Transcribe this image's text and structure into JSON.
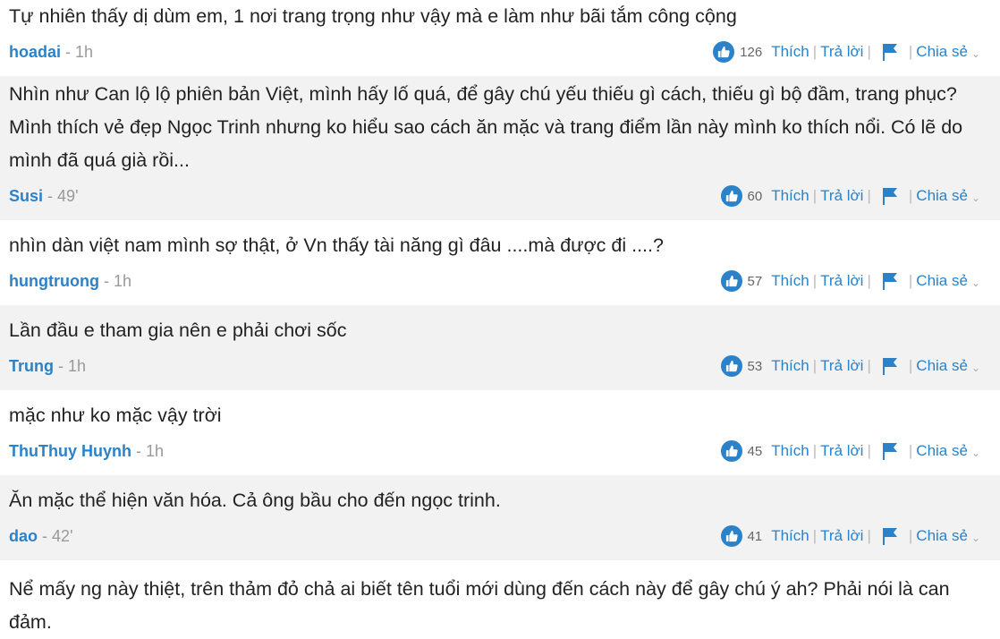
{
  "comments": [
    {
      "text": "Tự nhiên thấy dị dùm em, 1 nơi trang trọng như vậy mà e làm như bãi tắm công cộng",
      "author": "hoadai",
      "time": "1h",
      "likes": "126"
    },
    {
      "text": "Nhìn như Can lộ lộ phiên bản Việt, mình hấy lố quá, để gây chú yếu thiếu gì cách, thiếu gì bộ đầm, trang phục? Mình thích vẻ đẹp Ngọc Trinh nhưng ko hiểu sao cách ăn mặc và trang điểm lần này mình ko thích nổi. Có lẽ do mình đã quá già rồi...",
      "author": "Susi",
      "time": "49'",
      "likes": "60"
    },
    {
      "text": "nhìn dàn việt nam mình sợ thật, ở Vn thấy tài năng gì đâu ....mà được đi ....?",
      "author": "hungtruong",
      "time": "1h",
      "likes": "57"
    },
    {
      "text": "Lần đầu e tham gia nên e phải chơi sốc",
      "author": "Trung",
      "time": "1h",
      "likes": "53"
    },
    {
      "text": "mặc như ko mặc vậy trời",
      "author": "ThuThuy Huynh",
      "time": "1h",
      "likes": "45"
    },
    {
      "text": "Ăn mặc thể hiện văn hóa. Cả ông bầu cho đến ngọc trinh.",
      "author": "dao",
      "time": "42'",
      "likes": "41"
    },
    {
      "text": "Nể mấy ng này thiệt, trên thảm đỏ chả ai biết tên tuổi mới dùng đến cách này để gây chú ý ah? Phải nói là can đảm.",
      "author": "",
      "time": "",
      "likes": ""
    }
  ],
  "actions": {
    "like_label": "Thích",
    "reply_label": "Trả lời",
    "share_label": "Chia sẻ"
  },
  "icons": {
    "like": "thumbs-up-icon",
    "flag": "flag-icon",
    "chevron": "chevron-down-icon"
  },
  "colors": {
    "accent": "#2b82c9",
    "alt_row": "#f2f2f2",
    "text": "#222222",
    "muted": "#999999"
  }
}
